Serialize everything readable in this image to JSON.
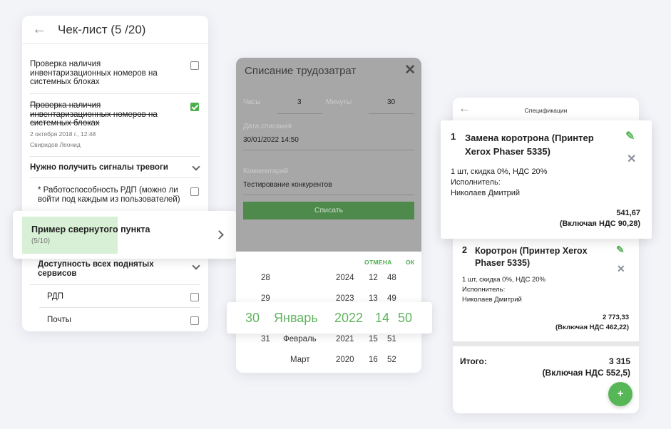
{
  "checklist": {
    "title": "Чек-лист (5 /20)",
    "items": [
      {
        "text": "Проверка наличия инвентаризационных номеров на системных блоках"
      },
      {
        "text": "Проверка наличия инвентаризационных номеров на системных блоках",
        "date": "2 октября 2018 г., 12:48",
        "author": "Свиридов Леонид"
      },
      {
        "text": "Нужно получить сигналы тревоги"
      },
      {
        "text": "* Работоспособность РДП (можно ли войти под каждым из пользователей)"
      },
      {
        "text": "Доступность всех поднятых сервисов"
      },
      {
        "text": "РДП"
      },
      {
        "text": "Почты"
      }
    ],
    "collapsed": {
      "title": "Пример свернутого пункта",
      "count": "(5/10)"
    }
  },
  "writeoff": {
    "title": "Списание трудозатрат",
    "hours_label": "Часы",
    "hours_value": "3",
    "minutes_label": "Минуты",
    "minutes_value": "30",
    "date_label": "Дата списания",
    "date_value": "30/01/2022 14:50",
    "comment_label": "Комментарий",
    "comment_value": "Тестирование конкурентов",
    "submit_label": "Списать",
    "cancel_label": "ОТМЕНА",
    "ok_label": "ОК",
    "picker": {
      "row1": [
        "28",
        "",
        "2024",
        "12",
        "48"
      ],
      "row2": [
        "29",
        "",
        "2023",
        "13",
        "49"
      ],
      "selected": [
        "30",
        "Январь",
        "2022",
        "14",
        "50"
      ],
      "row4": [
        "31",
        "Февраль",
        "2021",
        "15",
        "51"
      ],
      "row5": [
        "",
        "Март",
        "2020",
        "16",
        "52"
      ]
    }
  },
  "spec": {
    "title": "Спецификации",
    "items": [
      {
        "num": "1",
        "name": "Замена коротрона (Принтер Xerox Phaser 5335)",
        "details": "1 шт, скидка 0%, НДС 20%",
        "executor_label": "Исполнитель:",
        "executor": "Николаев Дмитрий",
        "price": "541,67",
        "vat": "(Включая НДС 90,28)"
      },
      {
        "num": "2",
        "name": "Коротрон (Принтер Xerox Phaser 5335)",
        "details": "1 шт, скидка 0%, НДС 20%",
        "executor_label": "Исполнитель:",
        "executor": "Николаев Дмитрий",
        "price": "2 773,33",
        "vat": "(Включая НДС 462,22)"
      }
    ],
    "total_label": "Итого:",
    "total_value": "3 315",
    "total_vat": "(Включая НДС 552,5)",
    "fab_label": "+"
  },
  "icons": {
    "back": "arrow-left-icon",
    "close": "close-icon",
    "edit": "pencil-icon",
    "delete": "x-icon",
    "chevron": "chevron-icon",
    "checkbox": "checkbox-icon"
  },
  "colors": {
    "accent": "#4cae4c",
    "button": "#4e8a4c",
    "overlay": "#a7a7a7",
    "picker_selected": "#62b45f",
    "progress": "#d8f0d5"
  }
}
